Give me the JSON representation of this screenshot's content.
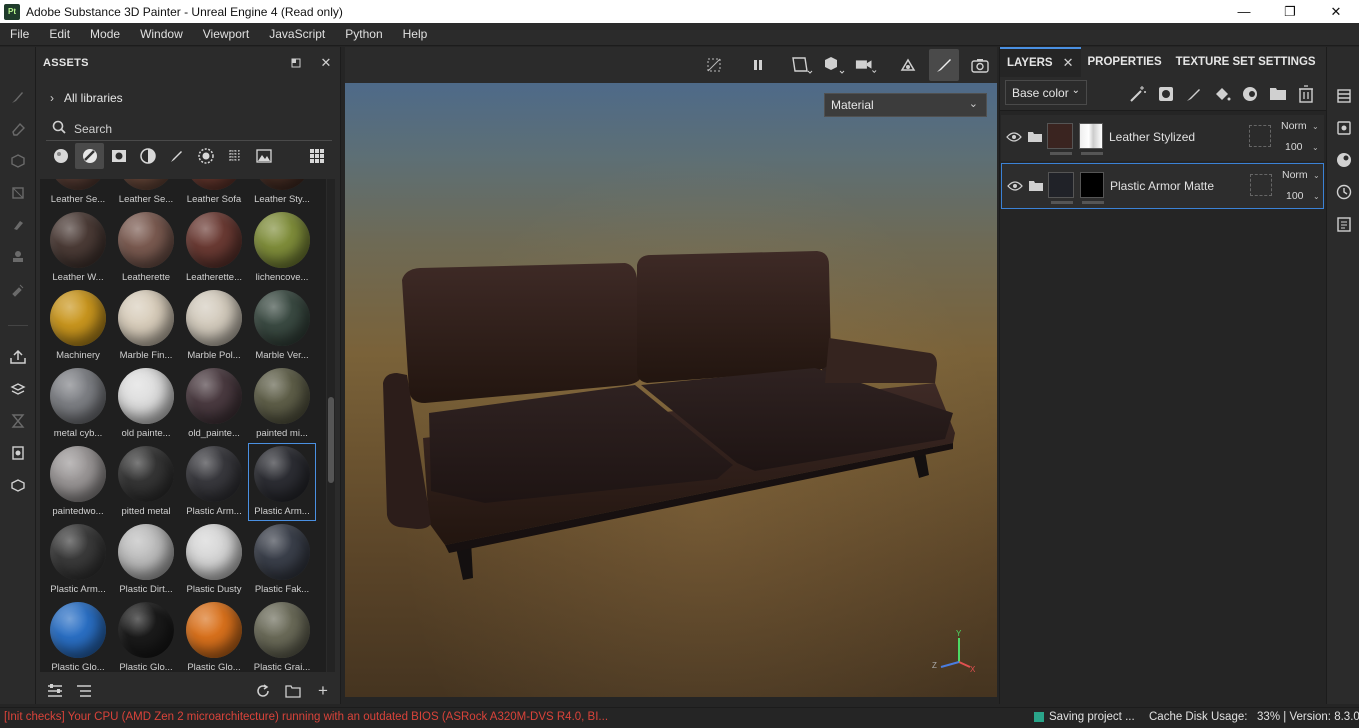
{
  "window": {
    "app_icon_text": "Pt",
    "title": "Adobe Substance 3D Painter - Unreal Engine 4 (Read only)",
    "controls": [
      "minimize-icon",
      "maximize-icon",
      "close-icon"
    ]
  },
  "menu": [
    "File",
    "Edit",
    "Mode",
    "Window",
    "Viewport",
    "JavaScript",
    "Python",
    "Help"
  ],
  "left_tools": [
    "paint-brush-icon",
    "eraser-icon",
    "projection-icon",
    "polygon-fill-icon",
    "smudge-icon",
    "clone-stamp-icon",
    "color-picker-icon",
    "export-icon",
    "bake-icon",
    "hourglass-icon",
    "display-settings-icon",
    "shelf-icon"
  ],
  "assets": {
    "title": "ASSETS",
    "libraries_label": "All libraries",
    "search_placeholder": "Search",
    "filters": [
      "materials-filter-icon",
      "smart-materials-filter-icon",
      "masks-filter-icon",
      "smart-masks-filter-icon",
      "brushes-filter-icon",
      "alphas-filter-icon",
      "textures-filter-icon",
      "environments-filter-icon",
      "grid-view-icon"
    ],
    "items": [
      {
        "label": "Leather Se...",
        "color": "#5a3f36"
      },
      {
        "label": "Leather Se...",
        "color": "#6b4a3c"
      },
      {
        "label": "Leather Sofa",
        "color": "#6a3a30"
      },
      {
        "label": "Leather Sty...",
        "color": "#4a3026"
      },
      {
        "label": "Leather W...",
        "color": "#4b3b36"
      },
      {
        "label": "Leatherette",
        "color": "#7a5a50"
      },
      {
        "label": "Leatherette...",
        "color": "#6a3a33"
      },
      {
        "label": "lichencove...",
        "color": "#7f8d3a"
      },
      {
        "label": "Machinery",
        "color": "#c9961e"
      },
      {
        "label": "Marble Fin...",
        "color": "#d8cdbb"
      },
      {
        "label": "Marble Pol...",
        "color": "#d3cbbd"
      },
      {
        "label": "Marble Ver...",
        "color": "#3a4a42"
      },
      {
        "label": "metal cyb...",
        "color": "#7d7f84"
      },
      {
        "label": "old painte...",
        "color": "#dedede"
      },
      {
        "label": "old_painte...",
        "color": "#4a3a40"
      },
      {
        "label": "painted mi...",
        "color": "#5e5e48"
      },
      {
        "label": "paintedwo...",
        "color": "#9a9696"
      },
      {
        "label": "pitted metal",
        "color": "#353535"
      },
      {
        "label": "Plastic Arm...",
        "color": "#38383d"
      },
      {
        "label": "Plastic Arm...",
        "color": "#2c2d33",
        "selected": true
      },
      {
        "label": "Plastic Arm...",
        "color": "#3a3a3a"
      },
      {
        "label": "Plastic Dirt...",
        "color": "#bdbdbd"
      },
      {
        "label": "Plastic Dusty",
        "color": "#d6d6d6"
      },
      {
        "label": "Plastic Fak...",
        "color": "#3a3f4a"
      },
      {
        "label": "Plastic Glo...",
        "color": "#2a6fc4"
      },
      {
        "label": "Plastic Glo...",
        "color": "#1a1a1a"
      },
      {
        "label": "Plastic Glo...",
        "color": "#d9711c"
      },
      {
        "label": "Plastic Grai...",
        "color": "#6a6a58"
      }
    ],
    "footer_icons": [
      "filter-options-icon",
      "list-view-icon",
      "refresh-icon",
      "new-folder-icon",
      "add-icon"
    ]
  },
  "viewport": {
    "toolbar_icons": [
      "hide-ui-icon",
      "pause-icon",
      "selection-tool-icon",
      "camera-mode-icon",
      "camera-icon",
      "iray-icon",
      "paint-mode-icon",
      "screenshot-icon"
    ],
    "display_mode": "Material",
    "axis_labels": {
      "y": "Y",
      "z": "Z",
      "x": "X"
    }
  },
  "layers_panel": {
    "tabs": [
      "LAYERS",
      "PROPERTIES",
      "TEXTURE SET SETTINGS"
    ],
    "channel": "Base color",
    "tool_icons": [
      "add-effect-icon",
      "add-mask-icon",
      "add-paint-layer-icon",
      "add-fill-layer-icon",
      "add-color-selection-icon",
      "add-folder-icon",
      "delete-icon"
    ],
    "layers": [
      {
        "name": "Leather Stylized",
        "blend": "Norm",
        "opacity": "100",
        "swatch": "#3a2420",
        "selected": false
      },
      {
        "name": "Plastic Armor Matte",
        "blend": "Norm",
        "opacity": "100",
        "swatch": "#202228",
        "selected": true
      }
    ]
  },
  "right_icons": [
    "layers-stack-icon",
    "settings-icon",
    "display-icon",
    "history-icon",
    "clipboard-icon"
  ],
  "status": {
    "warning": "[Init checks] Your CPU (AMD Zen 2 microarchitecture) running with an outdated BIOS (ASRock A320M-DVS R4.0, BI...",
    "saving": "Saving project ...",
    "cache_label": "Cache Disk Usage:",
    "cache_value": "33%",
    "version": "Version: 8.3.0"
  },
  "colors": {
    "accent": "#4a90e2",
    "warning": "#d9433a",
    "saving": "#2aa58a"
  }
}
